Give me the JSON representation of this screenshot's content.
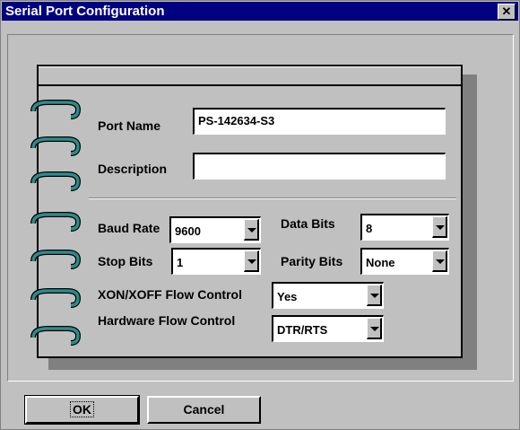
{
  "window": {
    "title": "Serial Port Configuration",
    "close_label": "✕"
  },
  "fields": {
    "port_name": {
      "label": "Port Name",
      "value": "PS-142634-S3"
    },
    "description": {
      "label": "Description",
      "value": ""
    },
    "baud_rate": {
      "label": "Baud Rate",
      "value": "9600"
    },
    "data_bits": {
      "label": "Data Bits",
      "value": "8"
    },
    "stop_bits": {
      "label": "Stop Bits",
      "value": "1"
    },
    "parity_bits": {
      "label": "Parity Bits",
      "value": "None"
    },
    "xon_xoff": {
      "label": "XON/XOFF Flow Control",
      "value": "Yes"
    },
    "hardware_flow": {
      "label": "Hardware Flow Control",
      "value": "DTR/RTS"
    }
  },
  "buttons": {
    "ok": "OK",
    "cancel": "Cancel"
  },
  "colors": {
    "titlebar": "#000080",
    "face": "#c0c0c0",
    "ring": "#2e8b8b"
  }
}
